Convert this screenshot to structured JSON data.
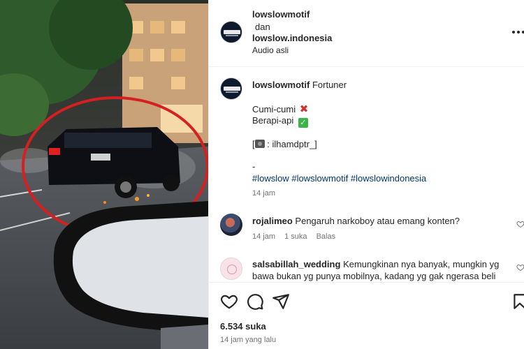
{
  "header": {
    "user1": "lowslowmotif",
    "connector": "dan",
    "user2": "lowslow.indonesia",
    "audio": "Audio asli"
  },
  "caption": {
    "username": "lowslowmotif",
    "text": "Fortuner",
    "line1": "Cumi-cumi",
    "line2": "Berapi-api",
    "credit": ": ilhamdptr_]",
    "credit_open": "[",
    "dash": "-",
    "hashtags": "#lowslow #lowslowmotif #lowslowindonesia",
    "time": "14 jam"
  },
  "comments": [
    {
      "username": "rojalimeo",
      "text": "Pengaruh narkoboy atau emang konten?",
      "time": "14 jam",
      "likes": "1 suka",
      "reply": "Balas"
    },
    {
      "username": "salsabillah_wedding",
      "text": "Kemungkinan nya banyak, mungkin yg",
      "text2": "bawa bukan yg punya mobilnya, kadang yg gak ngerasa beli"
    }
  ],
  "footer": {
    "likes": "6.534 suka",
    "time_ago": "14 jam yang lalu"
  },
  "icons": {
    "like": "heart-icon",
    "comment": "comment-icon",
    "share": "send-icon",
    "save": "bookmark-icon",
    "more": "more-icon"
  },
  "colors": {
    "text": "#262626",
    "muted": "#737373",
    "hashtag": "#00376b",
    "highlight_circle": "#d42020"
  }
}
